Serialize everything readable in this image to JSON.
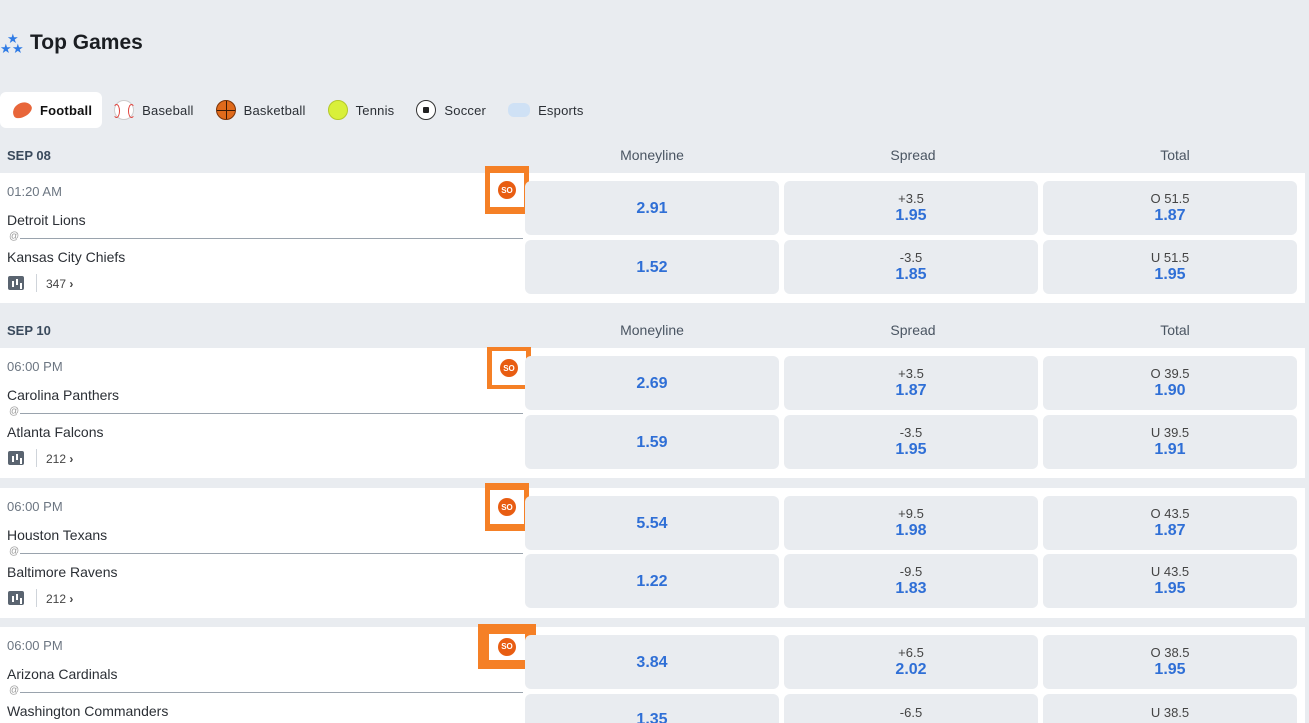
{
  "header": {
    "title": "Top Games",
    "icon": "stars-icon"
  },
  "tabs": [
    {
      "label": "Football",
      "icon": "football-icon",
      "active": true
    },
    {
      "label": "Baseball",
      "icon": "baseball-icon"
    },
    {
      "label": "Basketball",
      "icon": "basketball-icon"
    },
    {
      "label": "Tennis",
      "icon": "tennis-icon"
    },
    {
      "label": "Soccer",
      "icon": "soccer-icon"
    },
    {
      "label": "Esports",
      "icon": "esports-icon"
    }
  ],
  "columns": {
    "moneyline": "Moneyline",
    "spread": "Spread",
    "total": "Total"
  },
  "badge_label": "SO",
  "sections": [
    {
      "date": "SEP 08",
      "games": [
        {
          "time": "01:20 AM",
          "team1": "Detroit Lions",
          "team2": "Kansas City Chiefs",
          "count": "347",
          "odds": [
            {
              "ml": "2.91",
              "spread_line": "+3.5",
              "spread_price": "1.95",
              "total_line": "O 51.5",
              "total_price": "1.87"
            },
            {
              "ml": "1.52",
              "spread_line": "-3.5",
              "spread_price": "1.85",
              "total_line": "U 51.5",
              "total_price": "1.95"
            }
          ]
        }
      ]
    },
    {
      "date": "SEP 10",
      "games": [
        {
          "time": "06:00 PM",
          "team1": "Carolina Panthers",
          "team2": "Atlanta Falcons",
          "count": "212",
          "odds": [
            {
              "ml": "2.69",
              "spread_line": "+3.5",
              "spread_price": "1.87",
              "total_line": "O 39.5",
              "total_price": "1.90"
            },
            {
              "ml": "1.59",
              "spread_line": "-3.5",
              "spread_price": "1.95",
              "total_line": "U 39.5",
              "total_price": "1.91"
            }
          ]
        },
        {
          "time": "06:00 PM",
          "team1": "Houston Texans",
          "team2": "Baltimore Ravens",
          "count": "212",
          "odds": [
            {
              "ml": "5.54",
              "spread_line": "+9.5",
              "spread_price": "1.98",
              "total_line": "O 43.5",
              "total_price": "1.87"
            },
            {
              "ml": "1.22",
              "spread_line": "-9.5",
              "spread_price": "1.83",
              "total_line": "U 43.5",
              "total_price": "1.95"
            }
          ]
        },
        {
          "time": "06:00 PM",
          "team1": "Arizona Cardinals",
          "team2": "Washington Commanders",
          "count": "",
          "odds": [
            {
              "ml": "3.84",
              "spread_line": "+6.5",
              "spread_price": "2.02",
              "total_line": "O 38.5",
              "total_price": "1.95"
            },
            {
              "ml": "1.35",
              "spread_line": "-6.5",
              "spread_price": "",
              "total_line": "U 38.5",
              "total_price": ""
            }
          ]
        }
      ]
    }
  ]
}
